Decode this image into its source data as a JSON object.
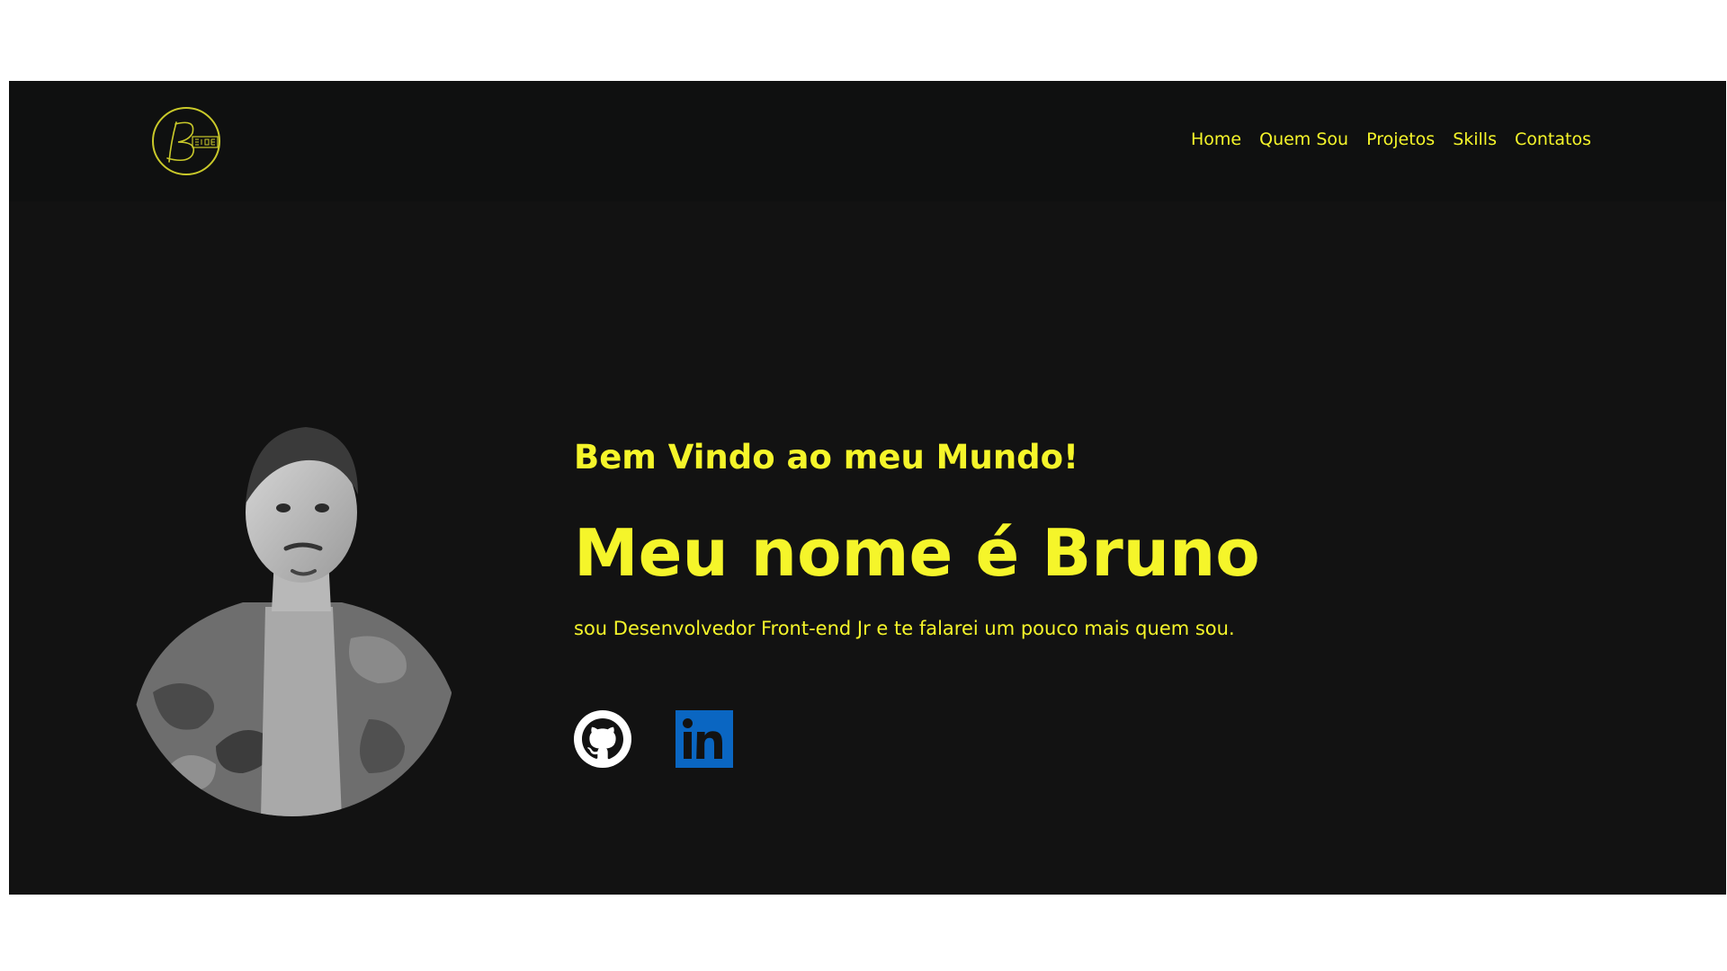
{
  "header": {
    "logo_icon": "b-code-signature-logo",
    "nav": [
      {
        "label": "Home"
      },
      {
        "label": "Quem Sou"
      },
      {
        "label": "Projetos"
      },
      {
        "label": "Skills"
      },
      {
        "label": "Contatos"
      }
    ]
  },
  "hero": {
    "photo_icon": "profile-photo",
    "greeting": "Bem Vindo ao meu Mundo!",
    "name": "Meu nome é Bruno",
    "tagline": "sou Desenvolvedor Front-end Jr e te falarei um pouco mais quem sou.",
    "social": [
      {
        "icon": "github-icon"
      },
      {
        "icon": "linkedin-icon"
      }
    ]
  },
  "colors": {
    "accent": "#f5f52a",
    "background": "#121212",
    "header_background": "#0f1010",
    "linkedin": "#0a66c2"
  }
}
